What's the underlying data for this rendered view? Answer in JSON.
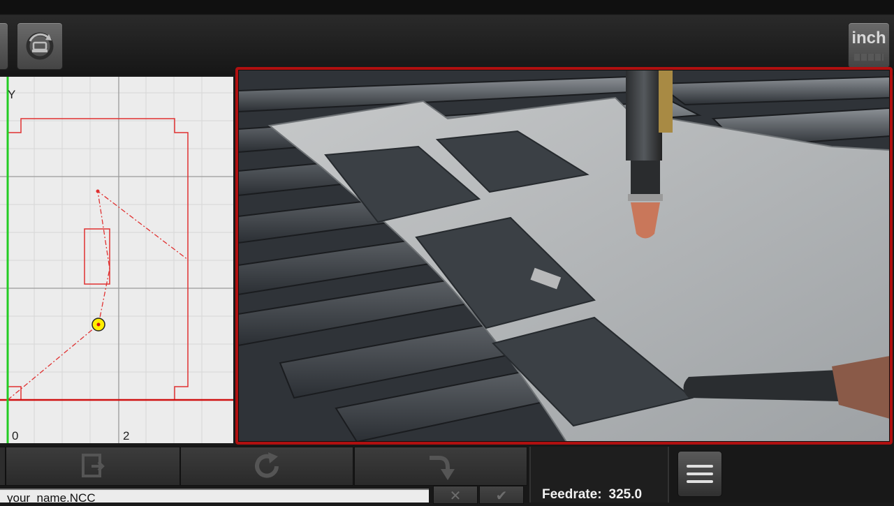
{
  "toolbar": {
    "regen_icon": "regen-gear-icon",
    "units_label": "inch"
  },
  "plot": {
    "y_axis_label": "Y",
    "x_ticks": [
      "0",
      "2"
    ],
    "colors": {
      "part": "#e03030",
      "axis_x": "#d01010",
      "axis_y": "#22cc22",
      "torch": "#ffee00"
    }
  },
  "camera": {
    "description_icon": "plasma-torch-camera-view"
  },
  "bottom": {
    "buttons": [
      {
        "icon": "load-file-icon"
      },
      {
        "icon": "refresh-icon"
      },
      {
        "icon": "redo-arrow-icon"
      }
    ],
    "file_name": "your_name.NCC",
    "cancel_glyph": "✕",
    "ok_glyph": "✔",
    "feedrate_label": "Feedrate:",
    "feedrate_value": "325.0",
    "menu_icon": "hamburger-menu-icon"
  }
}
